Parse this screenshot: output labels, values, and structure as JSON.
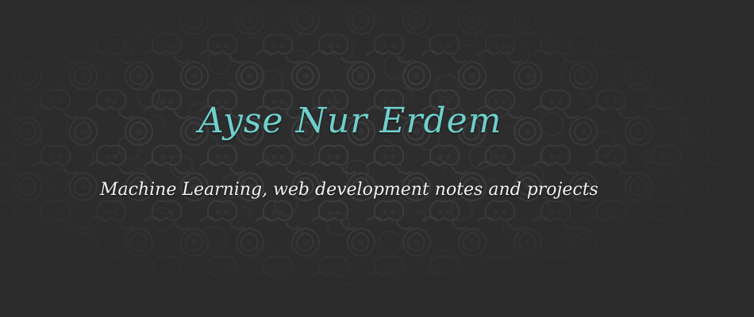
{
  "header": {
    "title": "Ayse Nur Erdem",
    "subtitle": "Machine Learning, web development notes and projects"
  },
  "colors": {
    "background": "#2b2b2c",
    "title": "#6fcfcb",
    "subtitle": "#f2f2f2",
    "pattern": "#3a3a3b"
  }
}
